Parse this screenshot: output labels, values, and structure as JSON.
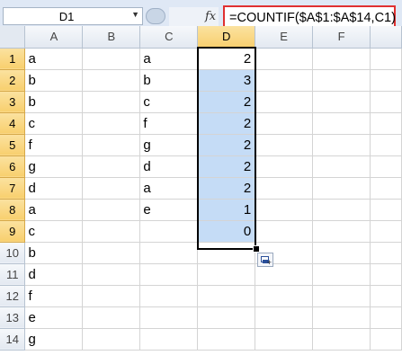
{
  "formula_bar": {
    "name_box": "D1",
    "fx_label": "fx",
    "formula": "=COUNTIF($A$1:$A$14,C1)"
  },
  "columns": [
    "A",
    "B",
    "C",
    "D",
    "E",
    "F"
  ],
  "rows": [
    {
      "n": "1",
      "A": "a",
      "C": "a",
      "D": "2"
    },
    {
      "n": "2",
      "A": "b",
      "C": "b",
      "D": "3"
    },
    {
      "n": "3",
      "A": "b",
      "C": "c",
      "D": "2"
    },
    {
      "n": "4",
      "A": "c",
      "C": "f",
      "D": "2"
    },
    {
      "n": "5",
      "A": "f",
      "C": "g",
      "D": "2"
    },
    {
      "n": "6",
      "A": "g",
      "C": "d",
      "D": "2"
    },
    {
      "n": "7",
      "A": "d",
      "C": "a",
      "D": "2"
    },
    {
      "n": "8",
      "A": "a",
      "C": "e",
      "D": "1"
    },
    {
      "n": "9",
      "A": "c",
      "C": "",
      "D": "0"
    },
    {
      "n": "10",
      "A": "b",
      "C": "",
      "D": ""
    },
    {
      "n": "11",
      "A": "d",
      "C": "",
      "D": ""
    },
    {
      "n": "12",
      "A": "f",
      "C": "",
      "D": ""
    },
    {
      "n": "13",
      "A": "e",
      "C": "",
      "D": ""
    },
    {
      "n": "14",
      "A": "g",
      "C": "",
      "D": ""
    }
  ],
  "colors": {
    "selection_fill": "#c5dcf6",
    "header_highlight": "#f8cf6e",
    "formula_box_border": "#e03030"
  }
}
